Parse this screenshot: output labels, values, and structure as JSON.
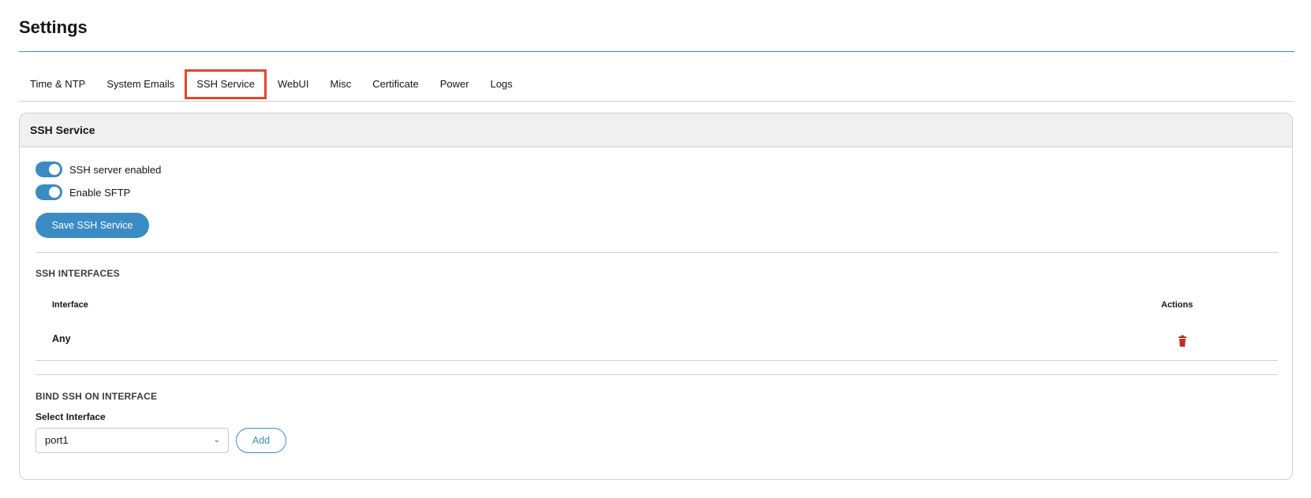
{
  "page": {
    "title": "Settings"
  },
  "tabs": [
    {
      "label": "Time & NTP"
    },
    {
      "label": "System Emails"
    },
    {
      "label": "SSH Service",
      "active": true
    },
    {
      "label": "WebUI"
    },
    {
      "label": "Misc"
    },
    {
      "label": "Certificate"
    },
    {
      "label": "Power"
    },
    {
      "label": "Logs"
    }
  ],
  "ssh_service": {
    "header": "SSH Service",
    "toggles": [
      {
        "label": "SSH server enabled",
        "on": true
      },
      {
        "label": "Enable SFTP",
        "on": true
      }
    ],
    "save_label": "Save SSH Service"
  },
  "interfaces": {
    "section_title": "SSH INTERFACES",
    "columns": {
      "interface": "Interface",
      "actions": "Actions"
    },
    "rows": [
      {
        "interface": "Any",
        "action_icon": "trash-icon"
      }
    ]
  },
  "bind": {
    "section_title": "BIND SSH ON INTERFACE",
    "field_label": "Select Interface",
    "selected": "port1",
    "add_label": "Add"
  },
  "colors": {
    "accent": "#3b8bc4",
    "active_tab_outline": "#e8432b",
    "delete": "#c0301c"
  }
}
